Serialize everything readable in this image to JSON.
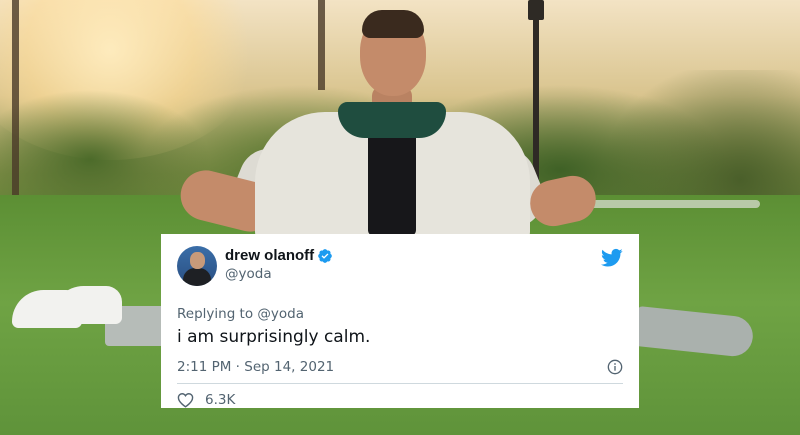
{
  "tweet": {
    "display_name": "drew olanoff",
    "handle": "@yoda",
    "reply_prefix": "Replying to ",
    "reply_to": "@yoda",
    "text": "i am surprisingly calm.",
    "timestamp": "2:11 PM · Sep 14, 2021",
    "likes": "6.3K"
  },
  "icons": {
    "verified": "verified-badge-icon",
    "brand": "twitter-bird-icon",
    "info": "info-icon",
    "like": "heart-icon"
  },
  "colors": {
    "brand_blue": "#1d9bf0",
    "text_primary": "#0f1419",
    "text_secondary": "#536471",
    "divider": "#cfd9de"
  }
}
